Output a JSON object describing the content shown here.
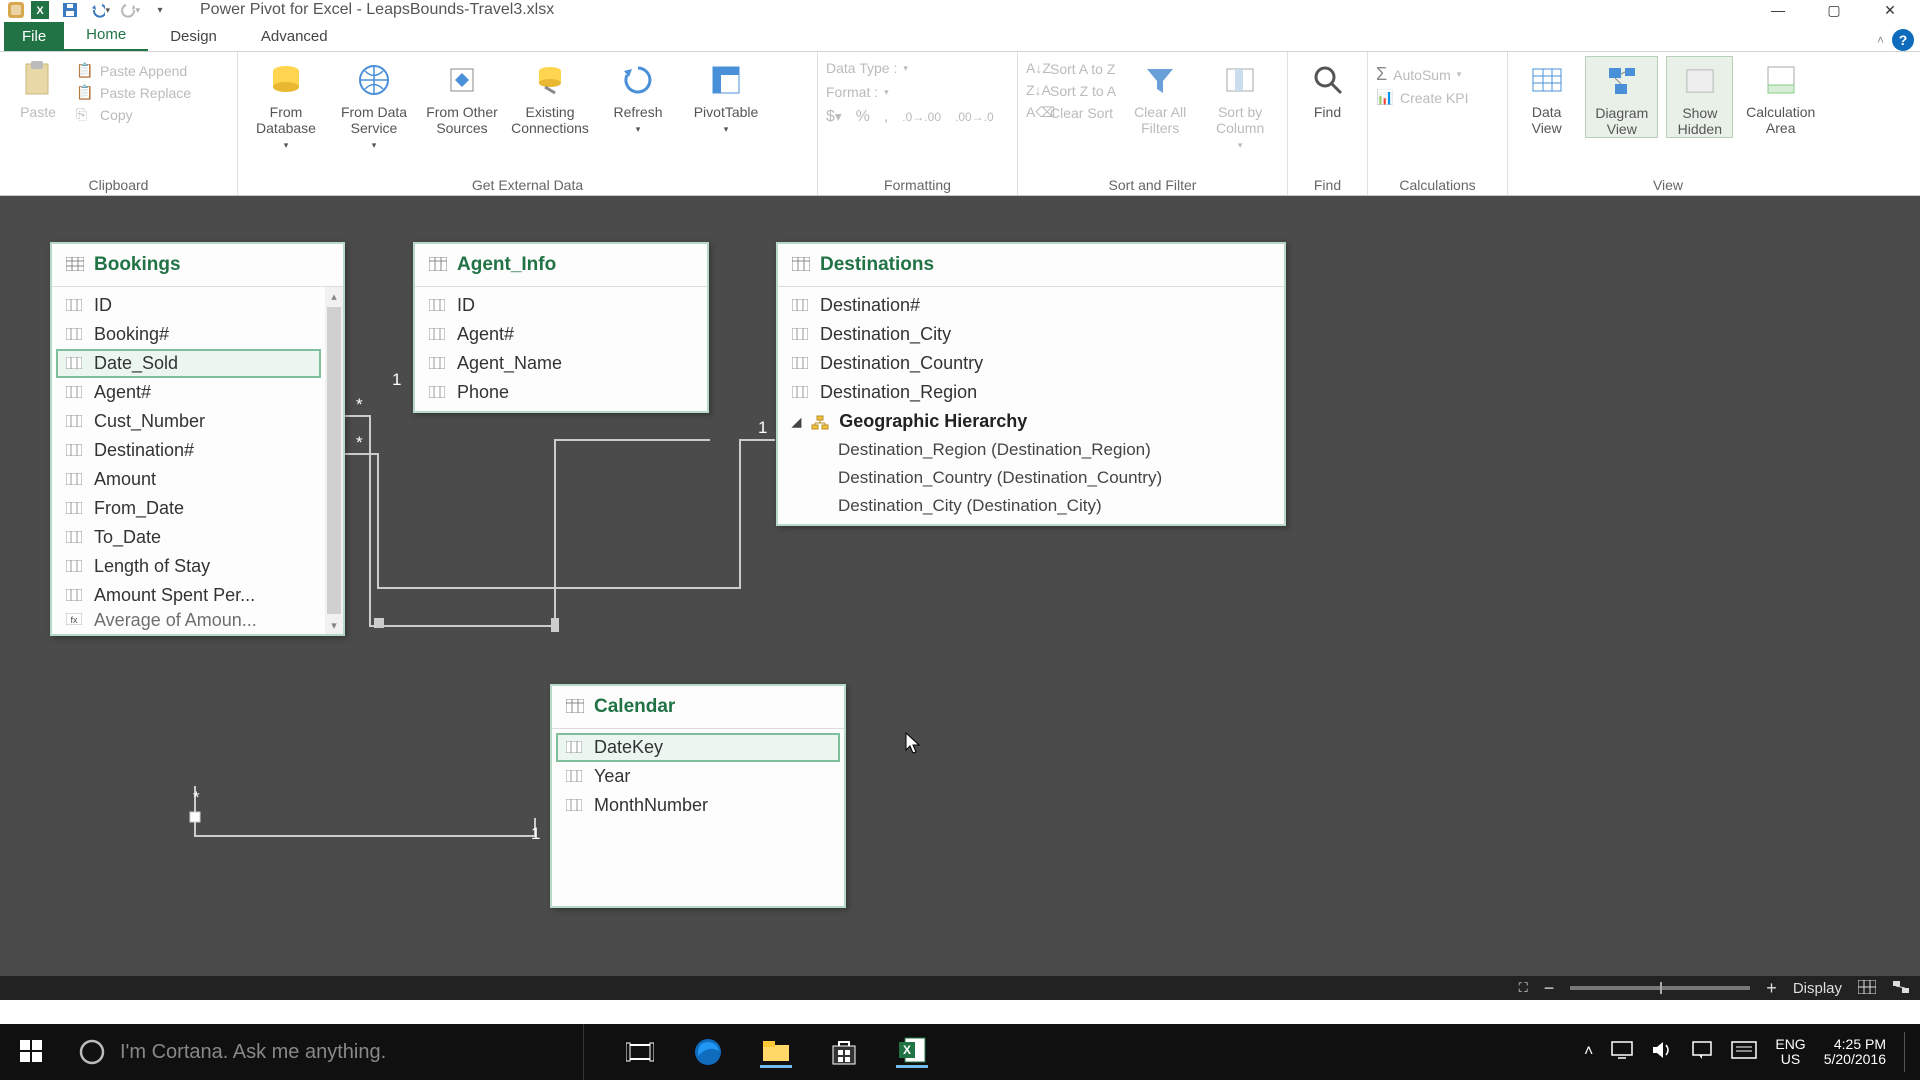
{
  "title": "Power Pivot for Excel - LeapsBounds-Travel3.xlsx",
  "tabs": {
    "file": "File",
    "home": "Home",
    "design": "Design",
    "advanced": "Advanced"
  },
  "ribbon": {
    "clipboard": {
      "paste": "Paste",
      "paste_append": "Paste Append",
      "paste_replace": "Paste Replace",
      "copy": "Copy",
      "group": "Clipboard"
    },
    "get_data": {
      "from_db": "From Database",
      "from_ds": "From Data Service",
      "from_other": "From Other Sources",
      "existing": "Existing Connections",
      "refresh": "Refresh",
      "pivot": "PivotTable",
      "group": "Get External Data"
    },
    "formatting": {
      "data_type": "Data Type :",
      "format": "Format :",
      "group": "Formatting"
    },
    "sort": {
      "az": "Sort A to Z",
      "za": "Sort Z to A",
      "clear_sort": "Clear Sort",
      "clear_filters": "Clear All Filters",
      "sortby": "Sort by Column",
      "group": "Sort and Filter"
    },
    "find": {
      "find": "Find",
      "group": "Find"
    },
    "calc": {
      "autosum": "AutoSum",
      "kpi": "Create KPI",
      "group": "Calculations"
    },
    "view": {
      "data_view": "Data View",
      "diagram_view": "Diagram View",
      "show_hidden": "Show Hidden",
      "calc_area": "Calculation Area",
      "group": "View"
    }
  },
  "tables": {
    "bookings": {
      "title": "Bookings",
      "fields": [
        "ID",
        "Booking#",
        "Date_Sold",
        "Agent#",
        "Cust_Number",
        "Destination#",
        "Amount",
        "From_Date",
        "To_Date",
        "Length of Stay",
        "Amount Spent Per...",
        "Average of Amoun..."
      ]
    },
    "agent": {
      "title": "Agent_Info",
      "fields": [
        "ID",
        "Agent#",
        "Agent_Name",
        "Phone"
      ]
    },
    "dest": {
      "title": "Destinations",
      "fields": [
        "Destination#",
        "Destination_City",
        "Destination_Country",
        "Destination_Region"
      ],
      "hierarchy_name": "Geographic Hierarchy",
      "hierarchy": [
        "Destination_Region (Destination_Region)",
        "Destination_Country (Destination_Country)",
        "Destination_City (Destination_City)"
      ]
    },
    "calendar": {
      "title": "Calendar",
      "fields": [
        "DateKey",
        "Year",
        "MonthNumber"
      ]
    }
  },
  "relations": {
    "one": "1",
    "many": "*"
  },
  "status": {
    "display": "Display"
  },
  "taskbar": {
    "cortana": "I'm Cortana. Ask me anything.",
    "lang1": "ENG",
    "lang2": "US",
    "time": "4:25 PM",
    "date": "5/20/2016"
  }
}
